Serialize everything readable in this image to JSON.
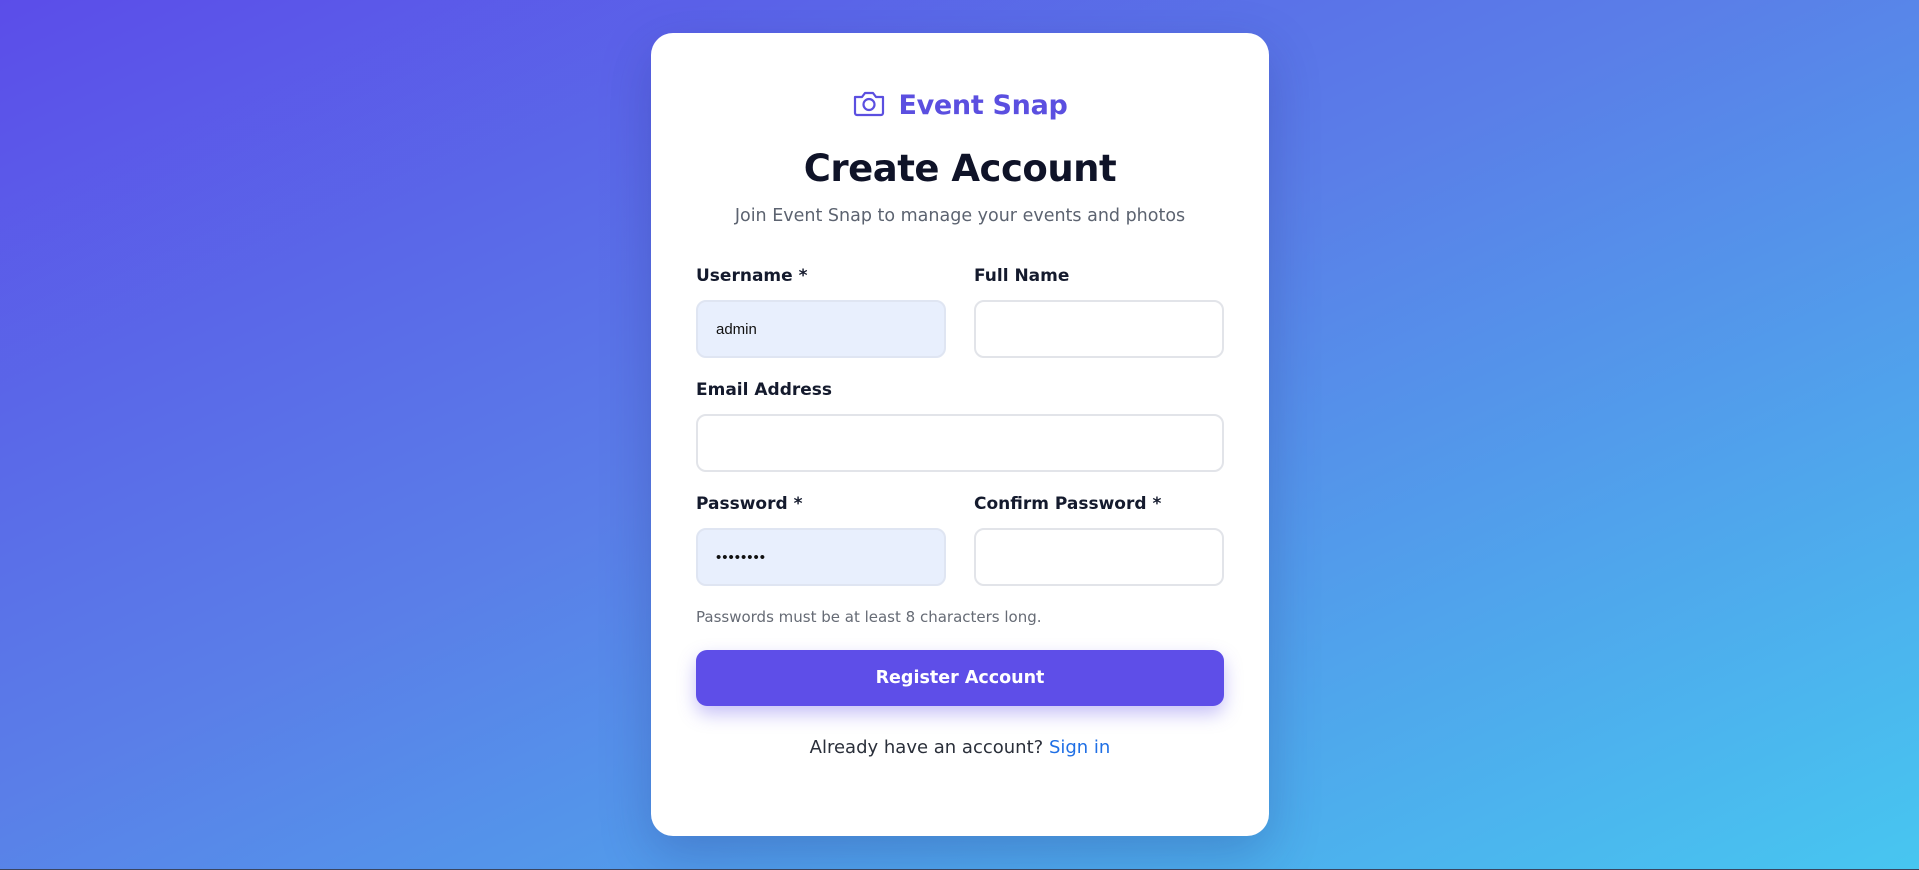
{
  "brand": {
    "name": "Event Snap",
    "icon": "camera-icon",
    "color": "#5b4fe0"
  },
  "header": {
    "title": "Create Account",
    "subtitle": "Join Event Snap to manage your events and photos"
  },
  "form": {
    "username": {
      "label": "Username *",
      "value": "admin"
    },
    "full_name": {
      "label": "Full Name",
      "value": ""
    },
    "email": {
      "label": "Email Address",
      "value": ""
    },
    "password": {
      "label": "Password *",
      "value": "••••••••"
    },
    "confirm_password": {
      "label": "Confirm Password *",
      "value": ""
    },
    "help_text": "Passwords must be at least 8 characters long.",
    "submit_label": "Register Account"
  },
  "footer": {
    "prompt": "Already have an account?",
    "link_label": "Sign in"
  },
  "colors": {
    "accent": "#5e4ee8",
    "link": "#1f6fe5",
    "autofill": "#e8effd"
  }
}
